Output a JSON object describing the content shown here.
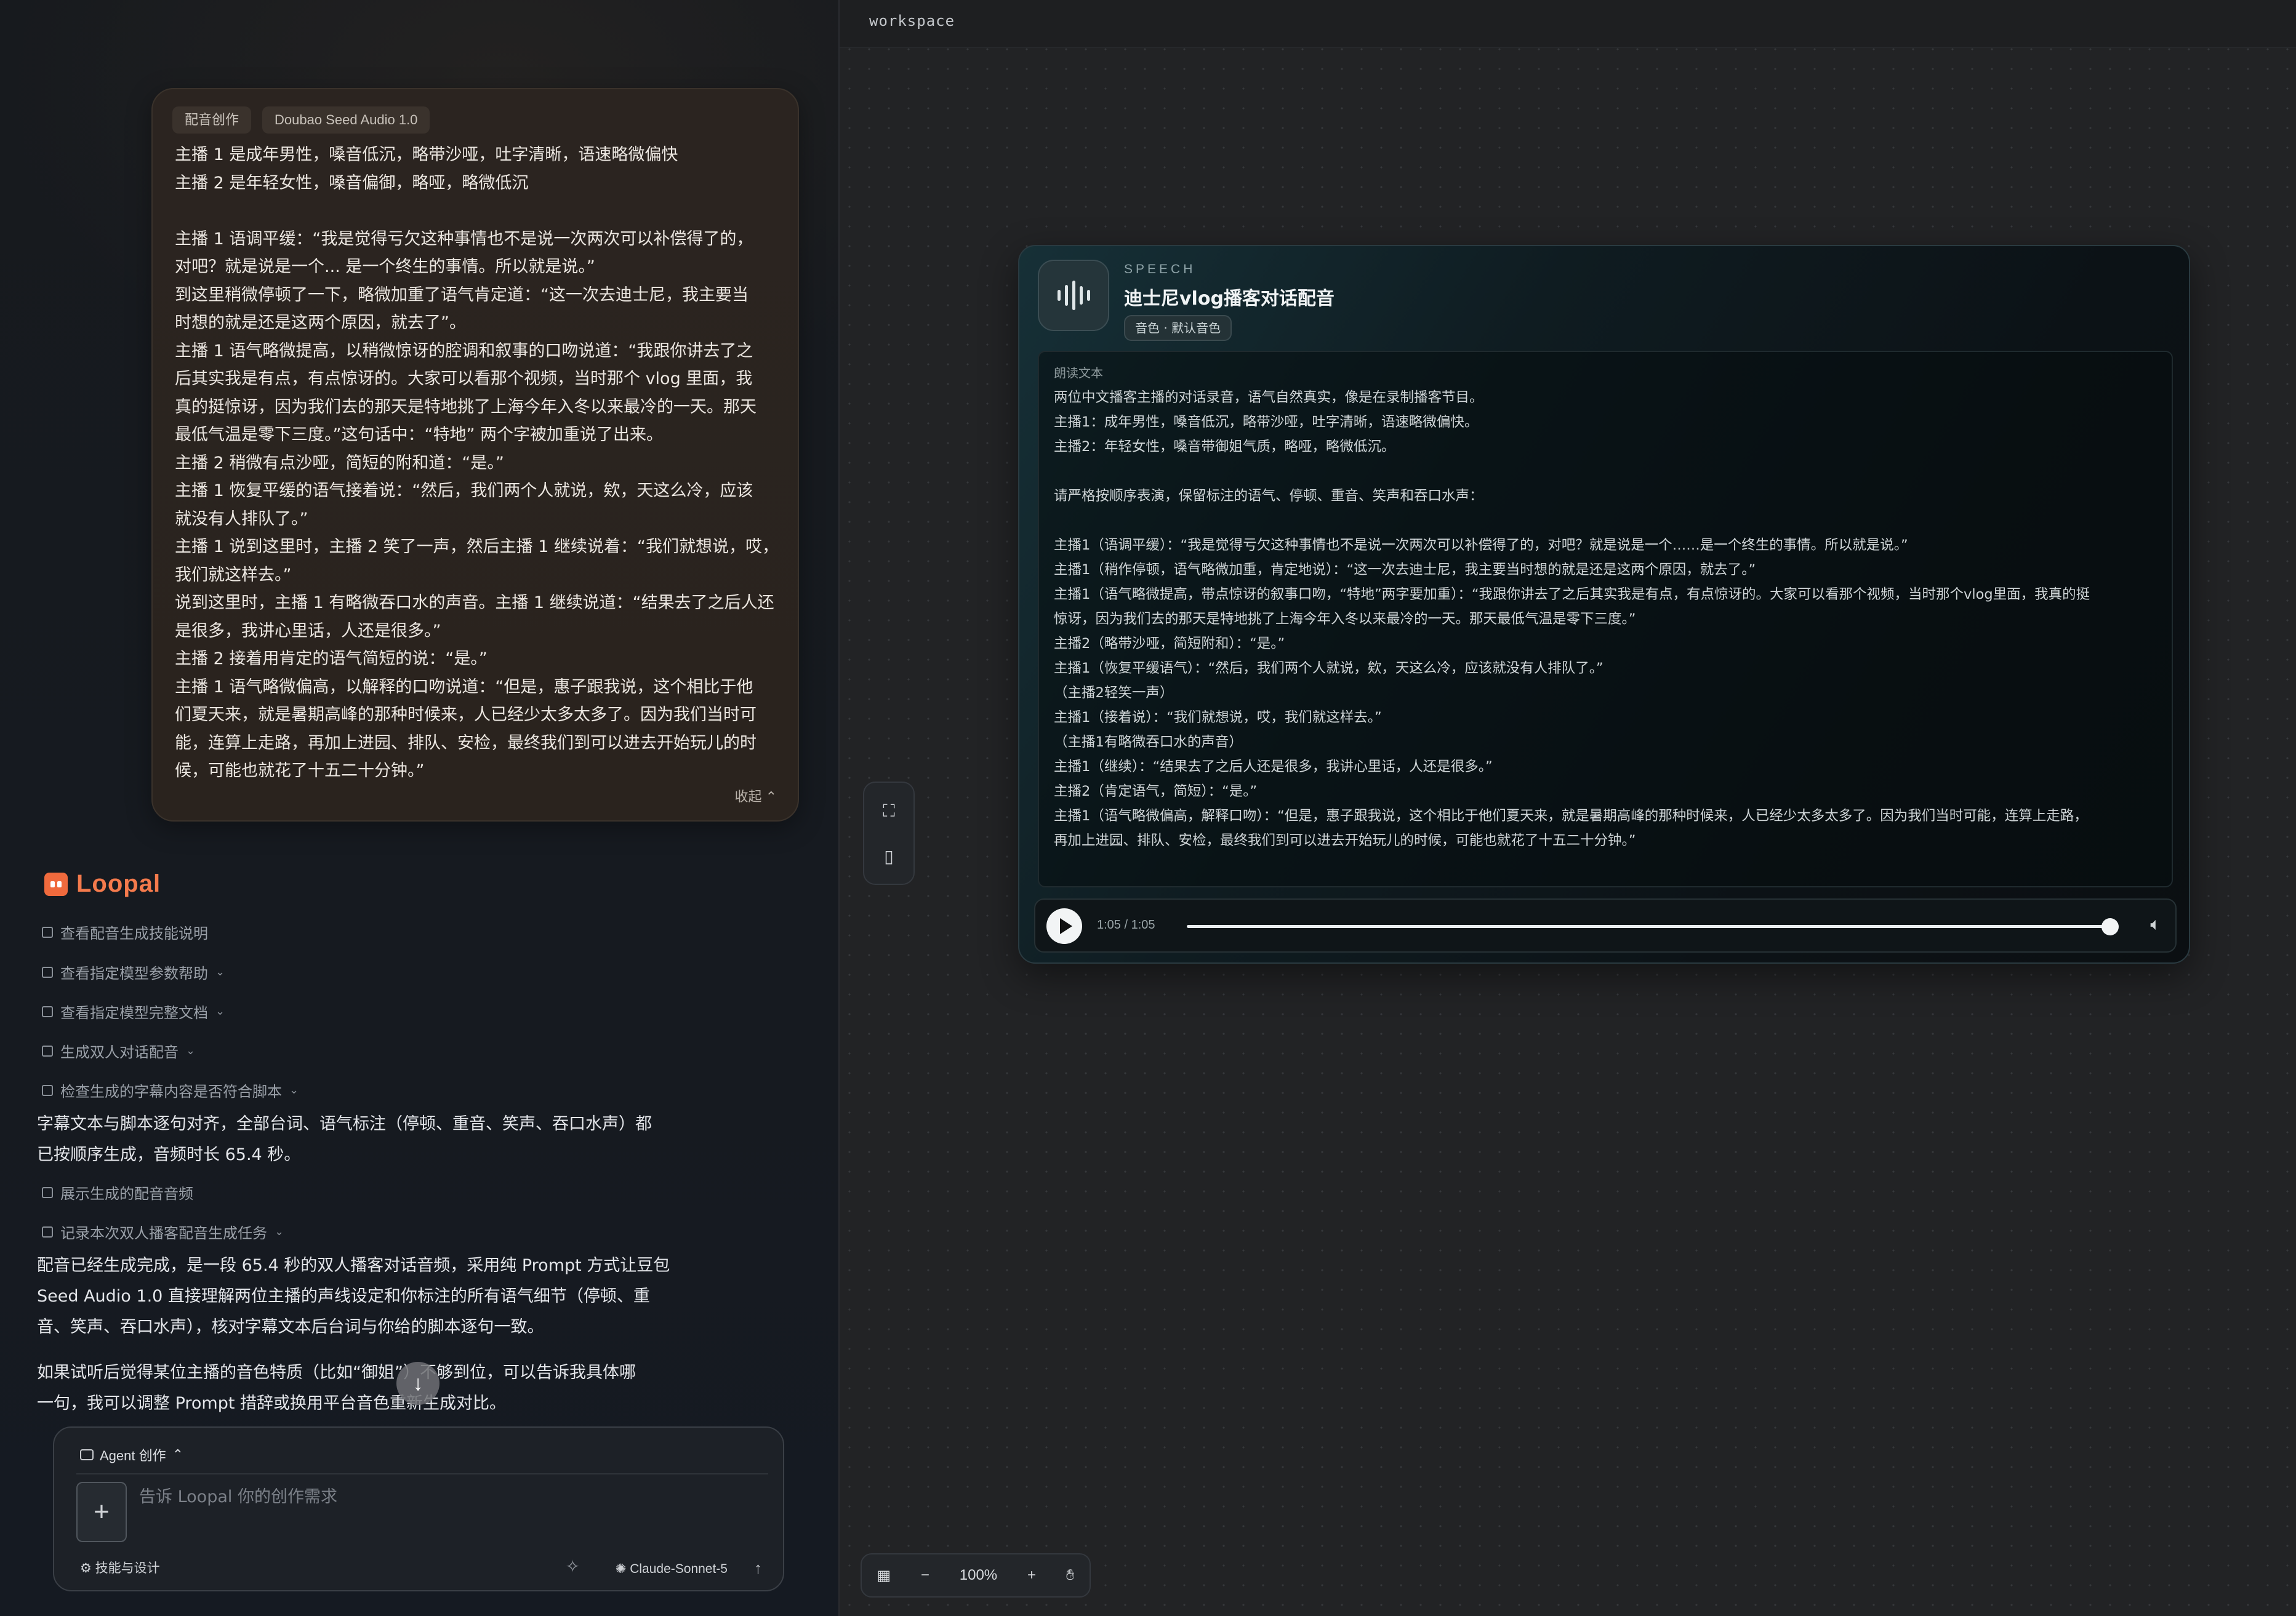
{
  "left": {
    "prompt_card": {
      "chip_skill": "配音创作",
      "chip_model": "Doubao Seed Audio 1.0",
      "text": "主播 1 是成年男性，嗓音低沉，略带沙哑，吐字清晰，语速略微偏快\n主播 2 是年轻女性，嗓音偏御，略哑，略微低沉\n\n主播 1 语调平缓：“我是觉得亏欠这种事情也不是说一次两次可以补偿得了的，\n对吧？就是说是一个... 是一个终生的事情。所以就是说。”\n到这里稍微停顿了一下，略微加重了语气肯定道：“这一次去迪士尼，我主要当\n时想的就是还是这两个原因，就去了”。\n主播 1 语气略微提高，以稍微惊讶的腔调和叙事的口吻说道：“我跟你讲去了之\n后其实我是有点，有点惊讶的。大家可以看那个视频，当时那个 vlog 里面，我\n真的挺惊讶，因为我们去的那天是特地挑了上海今年入冬以来最冷的一天。那天\n最低气温是零下三度。”这句话中：“特地” 两个字被加重说了出来。\n主播 2 稍微有点沙哑，简短的附和道：“是。”\n主播 1 恢复平缓的语气接着说：“然后，我们两个人就说，欸，天这么冷，应该\n就没有人排队了。”\n主播 1 说到这里时，主播 2 笑了一声，然后主播 1 继续说着：“我们就想说，哎，\n我们就这样去。”\n说到这里时，主播 1 有略微吞口水的声音。主播 1 继续说道：“结果去了之后人还\n是很多，我讲心里话，人还是很多。”\n主播 2 接着用肯定的语气简短的说：“是。”\n主播 1 语气略微偏高，以解释的口吻说道：“但是，惠子跟我说，这个相比于他\n们夏天来，就是暑期高峰的那种时候来，人已经少太多太多了。因为我们当时可\n能，连算上走路，再加上进园、排队、安检，最终我们到可以进去开始玩儿的时\n候，可能也就花了十五二十分钟。”",
      "collapse_label": "收起 ⌃"
    },
    "brand": "Loopal",
    "steps": [
      {
        "label": "查看配音生成技能说明",
        "chevron": ""
      },
      {
        "label": "查看指定模型参数帮助",
        "chevron": "⌄"
      },
      {
        "label": "查看指定模型完整文档",
        "chevron": "⌄"
      },
      {
        "label": "生成双人对话配音",
        "chevron": "⌄"
      },
      {
        "label": "检查生成的字幕内容是否符合脚本",
        "chevron": "⌄"
      }
    ],
    "result1": "字幕文本与脚本逐句对齐，全部台词、语气标注（停顿、重音、笑声、吞口水声）都\n已按顺序生成，音频时长 65.4 秒。",
    "step_show_audio": "展示生成的配音音频",
    "step_record": "记录本次双人播客配音生成任务",
    "result2": "配音已经生成完成，是一段 65.4 秒的双人播客对话音频，采用纯 Prompt 方式让豆包\nSeed Audio 1.0 直接理解两位主播的声线设定和你标注的所有语气细节（停顿、重\n音、笑声、吞口水声），核对字幕文本后台词与你给的脚本逐句一致。",
    "result3": "如果试听后觉得某位主播的音色特质（比如“御姐”）不够到位，可以告诉我具体哪\n一句，我可以调整 Prompt 措辞或换用平台音色重新生成对比。",
    "composer": {
      "mode_label": "Agent 创作",
      "placeholder": "告诉 Loopal 你的创作需求",
      "skills_label": "技能与设计",
      "model_label": "Claude-Sonnet-5"
    }
  },
  "workspace": {
    "title": "workspace",
    "speech_card": {
      "kind": "SPEECH",
      "title": "迪士尼vlog播客对话配音",
      "voice_badge": "音色 · 默认音色",
      "read_label": "朗读文本",
      "read_text": "两位中文播客主播的对话录音，语气自然真实，像是在录制播客节目。\n主播1：成年男性，嗓音低沉，略带沙哑，吐字清晰，语速略微偏快。\n主播2：年轻女性，嗓音带御姐气质，略哑，略微低沉。\n\n请严格按顺序表演，保留标注的语气、停顿、重音、笑声和吞口水声：\n\n主播1（语调平缓）：“我是觉得亏欠这种事情也不是说一次两次可以补偿得了的，对吧？就是说是一个……是一个终生的事情。所以就是说。”\n主播1（稍作停顿，语气略微加重，肯定地说）：“这一次去迪士尼，我主要当时想的就是还是这两个原因，就去了。”\n主播1（语气略微提高，带点惊讶的叙事口吻，“特地”两字要加重）：“我跟你讲去了之后其实我是有点，有点惊讶的。大家可以看那个视频，当时那个vlog里面，我真的挺\n惊讶，因为我们去的那天是特地挑了上海今年入冬以来最冷的一天。那天最低气温是零下三度。”\n主播2（略带沙哑，简短附和）：“是。”\n主播1（恢复平缓语气）：“然后，我们两个人就说，欸，天这么冷，应该就没有人排队了。”\n（主播2轻笑一声）\n主播1（接着说）：“我们就想说，哎，我们就这样去。”\n（主播1有略微吞口水的声音）\n主播1（继续）：“结果去了之后人还是很多，我讲心里话，人还是很多。”\n主播2（肯定语气，简短）：“是。”\n主播1（语气略微偏高，解释口吻）：“但是，惠子跟我说，这个相比于他们夏天来，就是暑期高峰的那种时候来，人已经少太多太多了。因为我们当时可能，连算上走路，\n再加上进园、排队、安检，最终我们到可以进去开始玩儿的时候，可能也就花了十五二十分钟。”",
      "player": {
        "time": "1:05 / 1:05",
        "progress": 1.0
      }
    },
    "zoom": {
      "minus": "−",
      "level": "100%",
      "plus": "+"
    }
  }
}
